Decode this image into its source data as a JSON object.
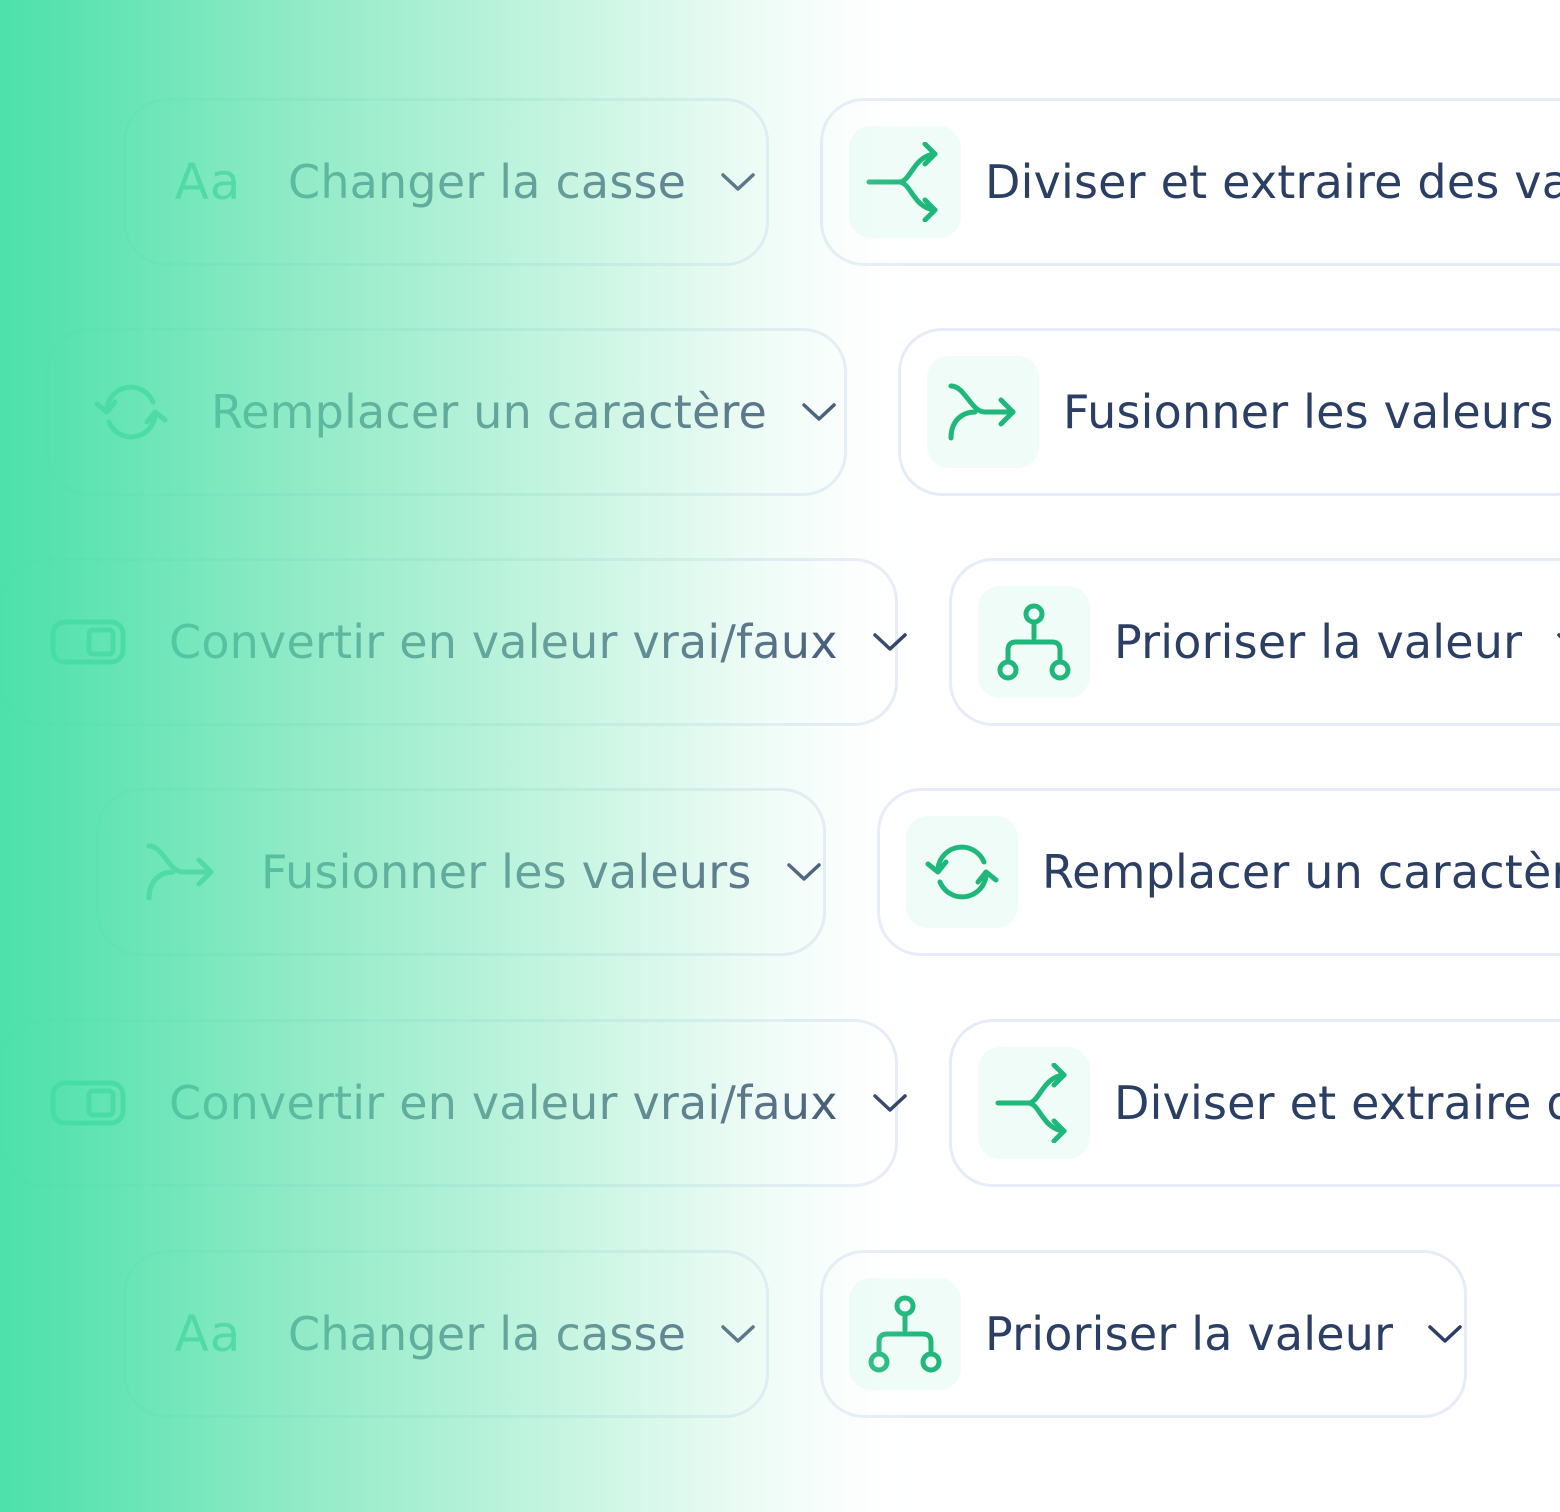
{
  "colors": {
    "accent_green": "#1fb77a",
    "text_navy": "#2b3e63",
    "border": "#e6ecf7",
    "icon_bg": "#effcf8",
    "gradient_green": "#4ae0a9"
  },
  "left_column": [
    {
      "label": "Changer la casse",
      "icon": "text-case-icon",
      "icon_text": "Aa"
    },
    {
      "label": "Remplacer un caractère",
      "icon": "refresh-icon"
    },
    {
      "label": "Convertir en valeur vrai/faux",
      "icon": "toggle-icon"
    },
    {
      "label": "Fusionner les valeurs",
      "icon": "merge-arrow-icon"
    },
    {
      "label": "Convertir en valeur vrai/faux",
      "icon": "toggle-icon"
    },
    {
      "label": "Changer la casse",
      "icon": "text-case-icon",
      "icon_text": "Aa"
    }
  ],
  "right_column": [
    {
      "label": "Diviser et extraire des vale",
      "icon": "split-arrow-icon"
    },
    {
      "label": "Fusionner les valeurs",
      "icon": "merge-arrow-icon"
    },
    {
      "label": "Prioriser la valeur",
      "icon": "hierarchy-icon"
    },
    {
      "label": "Remplacer un caractère",
      "icon": "refresh-icon"
    },
    {
      "label": "Diviser et extraire de",
      "icon": "split-arrow-icon"
    },
    {
      "label": "Prioriser la valeur",
      "icon": "hierarchy-icon"
    }
  ]
}
